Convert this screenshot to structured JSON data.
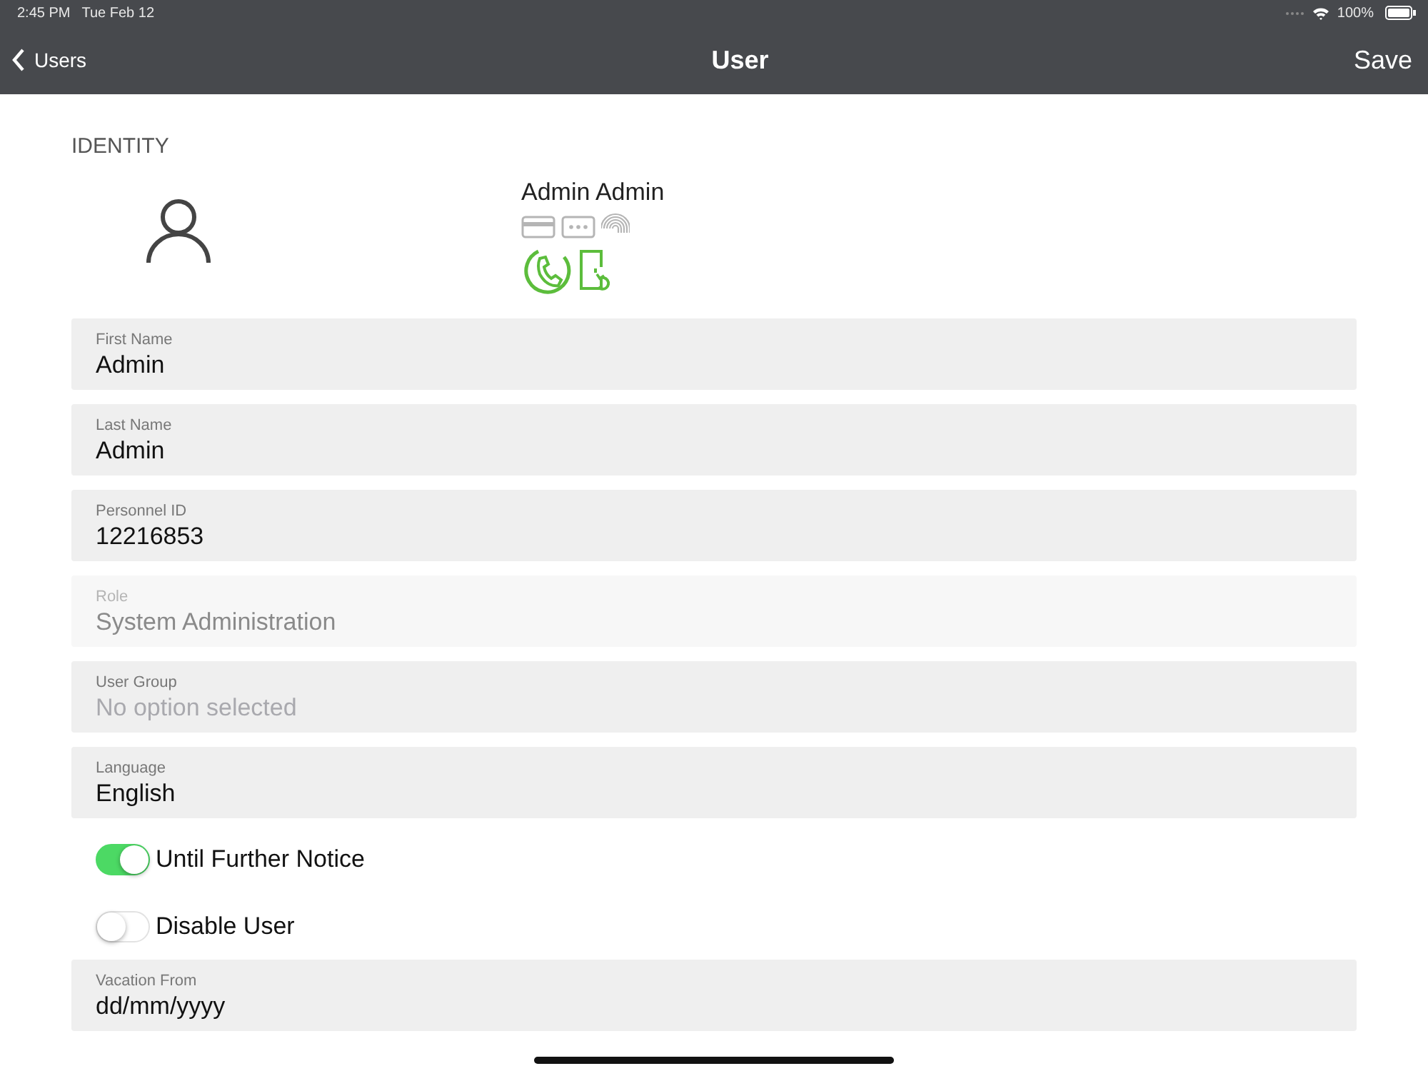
{
  "status_bar": {
    "time": "2:45 PM",
    "date": "Tue Feb 12",
    "battery": "100%"
  },
  "nav": {
    "back": "Users",
    "title": "User",
    "action": "Save"
  },
  "section": "IDENTITY",
  "user": {
    "display_name": "Admin Admin",
    "credentials": [
      {
        "kind": "card",
        "active": false
      },
      {
        "kind": "pin",
        "active": false
      },
      {
        "kind": "fingerprint",
        "active": false
      },
      {
        "kind": "phone",
        "active": true
      },
      {
        "kind": "door",
        "active": true
      }
    ]
  },
  "fields": [
    {
      "label": "First Name",
      "value": "Admin",
      "disabled": false
    },
    {
      "label": "Last Name",
      "value": "Admin",
      "disabled": false
    },
    {
      "label": "Personnel ID",
      "value": "12216853",
      "disabled": false
    },
    {
      "label": "Role",
      "value": "System Administration",
      "disabled": true
    },
    {
      "label": "User Group",
      "placeholder": "No option selected",
      "disabled": false
    },
    {
      "label": "Language",
      "value": "English",
      "disabled": false
    }
  ],
  "toggles": [
    {
      "label": "Until Further Notice",
      "on": true
    },
    {
      "label": "Disable User",
      "on": false
    }
  ],
  "more_fields": [
    {
      "label": "Vacation From",
      "value": "dd/mm/yyyy",
      "disabled": false
    }
  ]
}
